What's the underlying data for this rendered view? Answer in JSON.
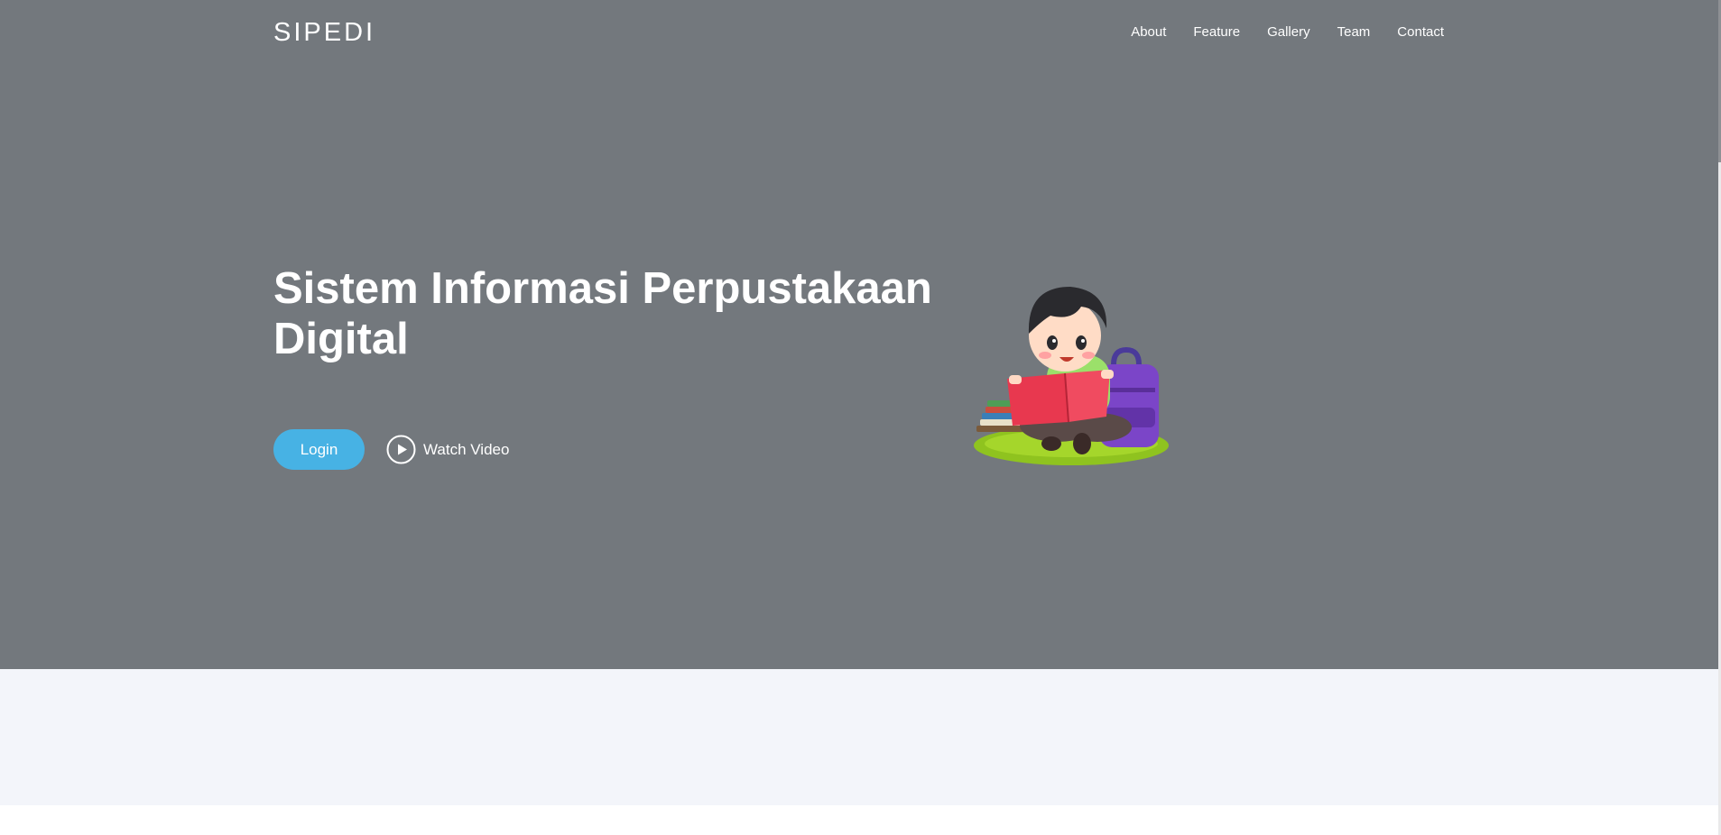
{
  "navbar": {
    "brand": "SIPEDI",
    "links": [
      "About",
      "Feature",
      "Gallery",
      "Team",
      "Contact"
    ]
  },
  "hero": {
    "title": "Sistem Informasi Perpustakaan Digital",
    "login_label": "Login",
    "watch_video_label": "Watch Video"
  },
  "icons": {
    "play": "play-circle-icon",
    "illustration": "child-reading-book-illustration"
  },
  "colors": {
    "hero_bg": "#73787d",
    "accent": "#47b2e4",
    "section_bg": "#f3f5fa"
  }
}
